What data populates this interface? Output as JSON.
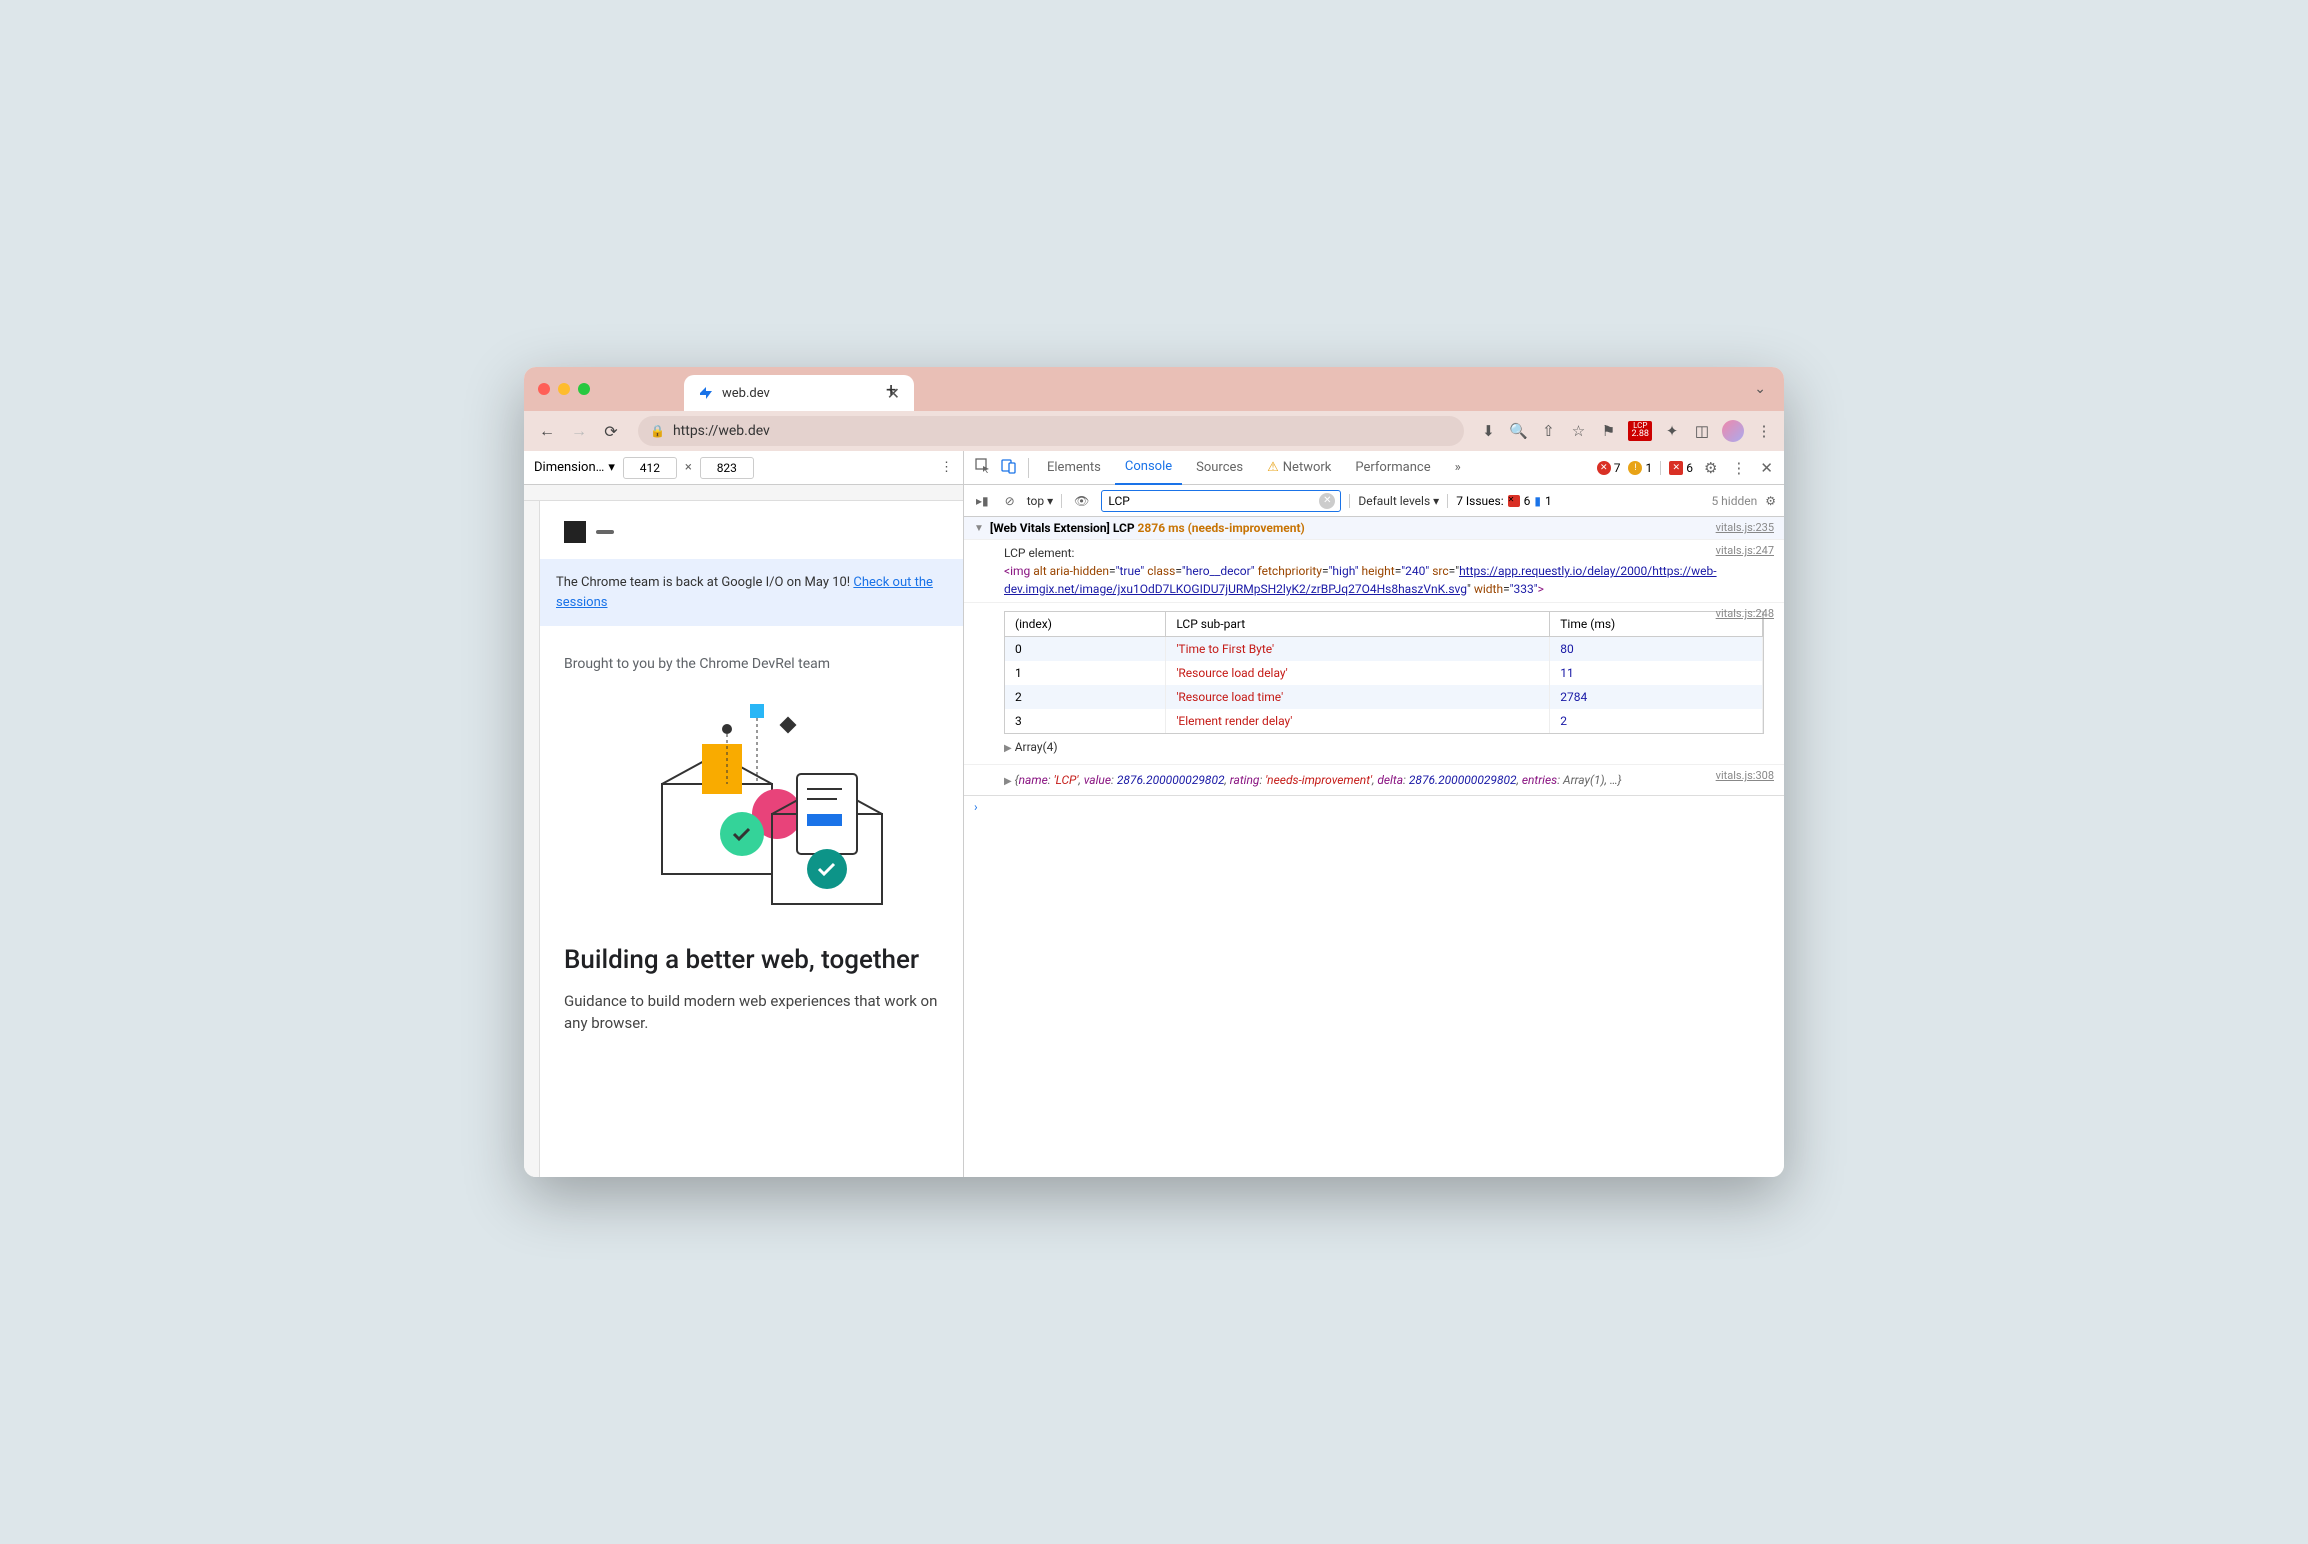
{
  "browser": {
    "tab_title": "web.dev",
    "url": "https://web.dev",
    "lcp_ext": {
      "label": "LCP",
      "value": "2.88"
    }
  },
  "device": {
    "dim_label": "Dimension…",
    "width": "412",
    "height": "823"
  },
  "page": {
    "banner_text": "The Chrome team is back at Google I/O on May 10! ",
    "banner_link": "Check out the sessions",
    "brought": "Brought to you by the Chrome DevRel team",
    "heading": "Building a better web, together",
    "sub": "Guidance to build modern web experiences that work on any browser."
  },
  "devtools": {
    "tabs": [
      "Elements",
      "Console",
      "Sources",
      "Network",
      "Performance"
    ],
    "errors": "7",
    "warnings": "1",
    "blocked": "6",
    "top": "top",
    "filter": "LCP",
    "levels": "Default levels",
    "issues_label": "7 Issues:",
    "issues_err": "6",
    "issues_info": "1",
    "hidden": "5 hidden"
  },
  "console": {
    "line1_prefix": "[Web Vitals Extension] LCP",
    "line1_value": "2876 ms (needs-improvement)",
    "src1": "vitals.js:235",
    "line2": "LCP element:",
    "src2": "vitals.js:247",
    "img_url": "https://app.requestly.io/delay/2000/https://web-dev.imgix.net/image/jxu1OdD7LKOGIDU7jURMpSH2lyK2/zrBPJq27O4Hs8haszVnK.svg",
    "src3": "vitals.js:248",
    "array_label": "Array(4)",
    "src4": "vitals.js:308",
    "obj": "{name: 'LCP', value: 2876.200000029802, rating: 'needs-improvement', delta: 2876.200000029802, entries: Array(1), …}",
    "table": {
      "headers": [
        "(index)",
        "LCP sub-part",
        "Time (ms)"
      ],
      "rows": [
        {
          "idx": "0",
          "part": "'Time to First Byte'",
          "time": "80"
        },
        {
          "idx": "1",
          "part": "'Resource load delay'",
          "time": "11"
        },
        {
          "idx": "2",
          "part": "'Resource load time'",
          "time": "2784"
        },
        {
          "idx": "3",
          "part": "'Element render delay'",
          "time": "2"
        }
      ]
    }
  },
  "chart_data": {
    "type": "table",
    "title": "LCP sub-part breakdown",
    "headers": [
      "(index)",
      "LCP sub-part",
      "Time (ms)"
    ],
    "rows": [
      [
        0,
        "Time to First Byte",
        80
      ],
      [
        1,
        "Resource load delay",
        11
      ],
      [
        2,
        "Resource load time",
        2784
      ],
      [
        3,
        "Element render delay",
        2
      ]
    ]
  }
}
